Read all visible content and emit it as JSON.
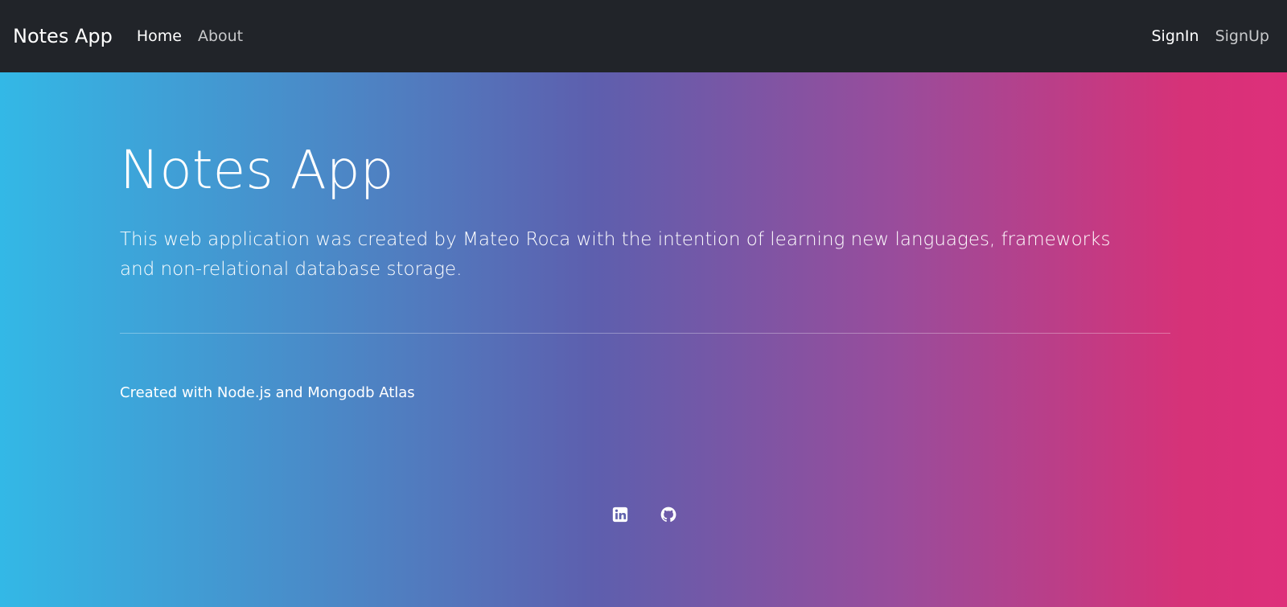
{
  "navbar": {
    "brand": "Notes App",
    "left_links": [
      {
        "label": "Home"
      },
      {
        "label": "About"
      }
    ],
    "right_links": [
      {
        "label": "SignIn"
      },
      {
        "label": "SignUp"
      }
    ]
  },
  "hero": {
    "title": "Notes App",
    "lead": "This web application was created by Mateo Roca with the intention of learning new languages, frameworks and non-relational database storage.",
    "credit": "Created with Node.js and Mongodb Atlas"
  },
  "social": {
    "icons": [
      "linkedin-icon",
      "github-icon"
    ]
  },
  "colors": {
    "navbar_bg": "#212429",
    "gradient_start": "#33b8e6",
    "gradient_mid": "#5d5fae",
    "gradient_end": "#de2f7a"
  }
}
